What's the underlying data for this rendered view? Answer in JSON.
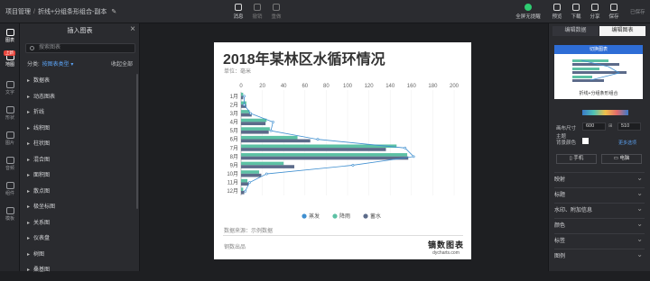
{
  "breadcrumb": {
    "root": "项目管理",
    "sep": "/",
    "current": "折线+分组条形组合-副本"
  },
  "toolbar": {
    "center": [
      {
        "label": "消息"
      },
      {
        "label": "撤销"
      },
      {
        "label": "重做"
      }
    ],
    "present": "全屏无提醒",
    "right": [
      {
        "label": "预览"
      },
      {
        "label": "下载"
      },
      {
        "label": "分享"
      },
      {
        "label": "保存"
      }
    ],
    "status": "已保存"
  },
  "rail": [
    {
      "label": "图表",
      "icon": "chart-icon"
    },
    {
      "label": "地图",
      "icon": "map-icon"
    },
    {
      "label": "文字",
      "icon": "text-icon"
    },
    {
      "label": "形状",
      "icon": "shape-icon"
    },
    {
      "label": "图片",
      "icon": "image-icon"
    },
    {
      "label": "音频",
      "icon": "audio-icon"
    },
    {
      "label": "组件",
      "icon": "component-icon"
    },
    {
      "label": "模板",
      "icon": "template-icon"
    }
  ],
  "rail_badge": "上新",
  "insert_panel": {
    "title": "插入图表",
    "search_placeholder": "搜索图表",
    "filter_label": "分类:",
    "filter_value": "按图表类型",
    "collapse_all": "收起全部",
    "items": [
      "数据表",
      "动态图表",
      "折线",
      "线积图",
      "柱状图",
      "混合图",
      "面积图",
      "散点图",
      "极坐标图",
      "关系图",
      "仪表盘",
      "树图",
      "桑基图"
    ]
  },
  "chart_card": {
    "unit": "单位：毫米",
    "source": "数据来源：示例数据",
    "footer": "钢数出品",
    "brand": "镝数图表",
    "brand_url": "dycharts.com"
  },
  "chart_data": {
    "type": "bar",
    "title": "2018年某林区水循环情况",
    "orientation": "horizontal",
    "categories": [
      "1月",
      "2月",
      "3月",
      "4月",
      "5月",
      "6月",
      "7月",
      "8月",
      "9月",
      "10月",
      "11月",
      "12月"
    ],
    "xlim": [
      0,
      200
    ],
    "xticks": [
      0,
      20,
      40,
      60,
      80,
      100,
      120,
      140,
      160,
      180,
      200
    ],
    "series": [
      {
        "name": "蒸发",
        "type": "line",
        "color": "#3f8fd0",
        "values": [
          3,
          3,
          9,
          30,
          28,
          72,
          154,
          162,
          105,
          24,
          8,
          4
        ]
      },
      {
        "name": "降雨",
        "type": "bar",
        "color": "#5cc1a4",
        "values": [
          2,
          5,
          8,
          24,
          27,
          53,
          146,
          156,
          40,
          17,
          6,
          2
        ]
      },
      {
        "name": "蓄水",
        "type": "bar",
        "color": "#5c6b8a",
        "values": [
          2,
          5,
          10,
          23,
          26,
          65,
          136,
          157,
          50,
          19,
          7,
          3
        ]
      }
    ],
    "legend_position": "bottom",
    "grid": true
  },
  "right_panel": {
    "tabs": [
      "编辑数据",
      "编辑图表"
    ],
    "thumb_header": "切换图表",
    "thumb_caption": "折线+分组条形组合",
    "theme_label": "主题",
    "size_label": "画布尺寸",
    "width": "600",
    "height": "510",
    "bg_label": "背景颜色",
    "more": "更多选项",
    "device_mobile": "手机",
    "device_pc": "电脑",
    "sections": [
      "映射",
      "标题",
      "水印、附加信息",
      "颜色",
      "标签",
      "图例"
    ]
  }
}
